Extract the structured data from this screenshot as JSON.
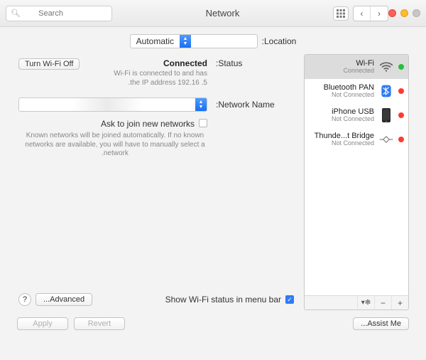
{
  "titlebar": {
    "title": "Network",
    "search_placeholder": "Search"
  },
  "location": {
    "label": "Location:",
    "value": "Automatic"
  },
  "sidebar": {
    "items": [
      {
        "name": "Wi-Fi",
        "status": "Connected",
        "dot": "green"
      },
      {
        "name": "Bluetooth PAN",
        "status": "Not Connected",
        "dot": "red"
      },
      {
        "name": "iPhone USB",
        "status": "Not Connected",
        "dot": "red"
      },
      {
        "name": "Thunde...t Bridge",
        "status": "Not Connected",
        "dot": "red"
      }
    ]
  },
  "detail": {
    "status_label": "Status:",
    "status_value": "Connected",
    "turn_off_label": "Turn Wi-Fi Off",
    "status_sub_line1": "Wi-Fi is connected to            and has",
    "status_sub_line2": "the IP address 192.16      .5.",
    "network_name_label": "Network Name:",
    "network_name_value": "",
    "ask_label": "Ask to join new networks",
    "ask_desc": "Known networks will be joined automatically. If no known networks are available, you will have to manually select a network.",
    "show_menu_label": "Show Wi-Fi status in menu bar",
    "advanced_label": "Advanced..."
  },
  "bottom": {
    "assist": "Assist Me...",
    "revert": "Revert",
    "apply": "Apply"
  }
}
